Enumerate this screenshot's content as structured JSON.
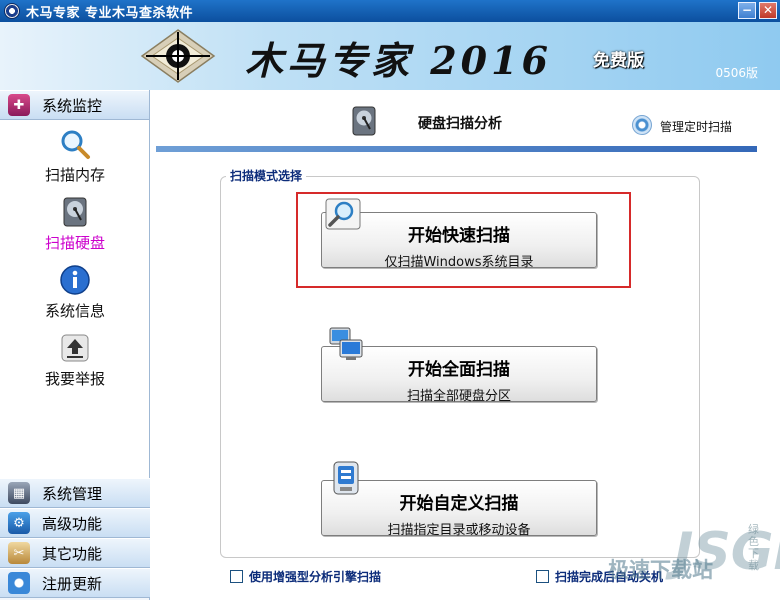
{
  "window": {
    "title": "木马专家  专业木马查杀软件",
    "minimize": "−",
    "close": "✕"
  },
  "banner": {
    "title": "木马专家 2016",
    "edition": "免费版",
    "version": "0506版"
  },
  "sidebar": {
    "top_section": "系统监控",
    "items": [
      {
        "label": "扫描内存",
        "icon": "magnifier-icon"
      },
      {
        "label": "扫描硬盘",
        "icon": "hard-disk-icon",
        "active": true
      },
      {
        "label": "系统信息",
        "icon": "info-icon"
      },
      {
        "label": "我要举报",
        "icon": "upload-report-icon"
      }
    ],
    "bottom_sections": [
      {
        "label": "系统管理",
        "icon": "system-manage-icon"
      },
      {
        "label": "高级功能",
        "icon": "advanced-icon"
      },
      {
        "label": "其它功能",
        "icon": "tools-icon"
      },
      {
        "label": "注册更新",
        "icon": "register-update-icon"
      }
    ]
  },
  "main": {
    "title": "硬盘扫描分析",
    "schedule_link": "管理定时扫描",
    "group_label": "扫描模式选择",
    "buttons": [
      {
        "title": "开始快速扫描",
        "subtitle": "仅扫描Windows系统目录"
      },
      {
        "title": "开始全面扫描",
        "subtitle": "扫描全部硬盘分区"
      },
      {
        "title": "开始自定义扫描",
        "subtitle": "扫描指定目录或移动设备"
      }
    ],
    "options": [
      {
        "label": "使用增强型分析引擎扫描",
        "checked": false
      },
      {
        "label": "扫描完成后自动关机",
        "checked": false
      }
    ]
  },
  "watermark": {
    "text1": "极速下载站",
    "text2": "JSGHO",
    "text3": "绿色下载"
  },
  "colors": {
    "title_bar": "#0c4f9e",
    "active_item": "#cc00cc",
    "highlight_border": "#d62a2a",
    "group_label": "#0c2c7a"
  }
}
